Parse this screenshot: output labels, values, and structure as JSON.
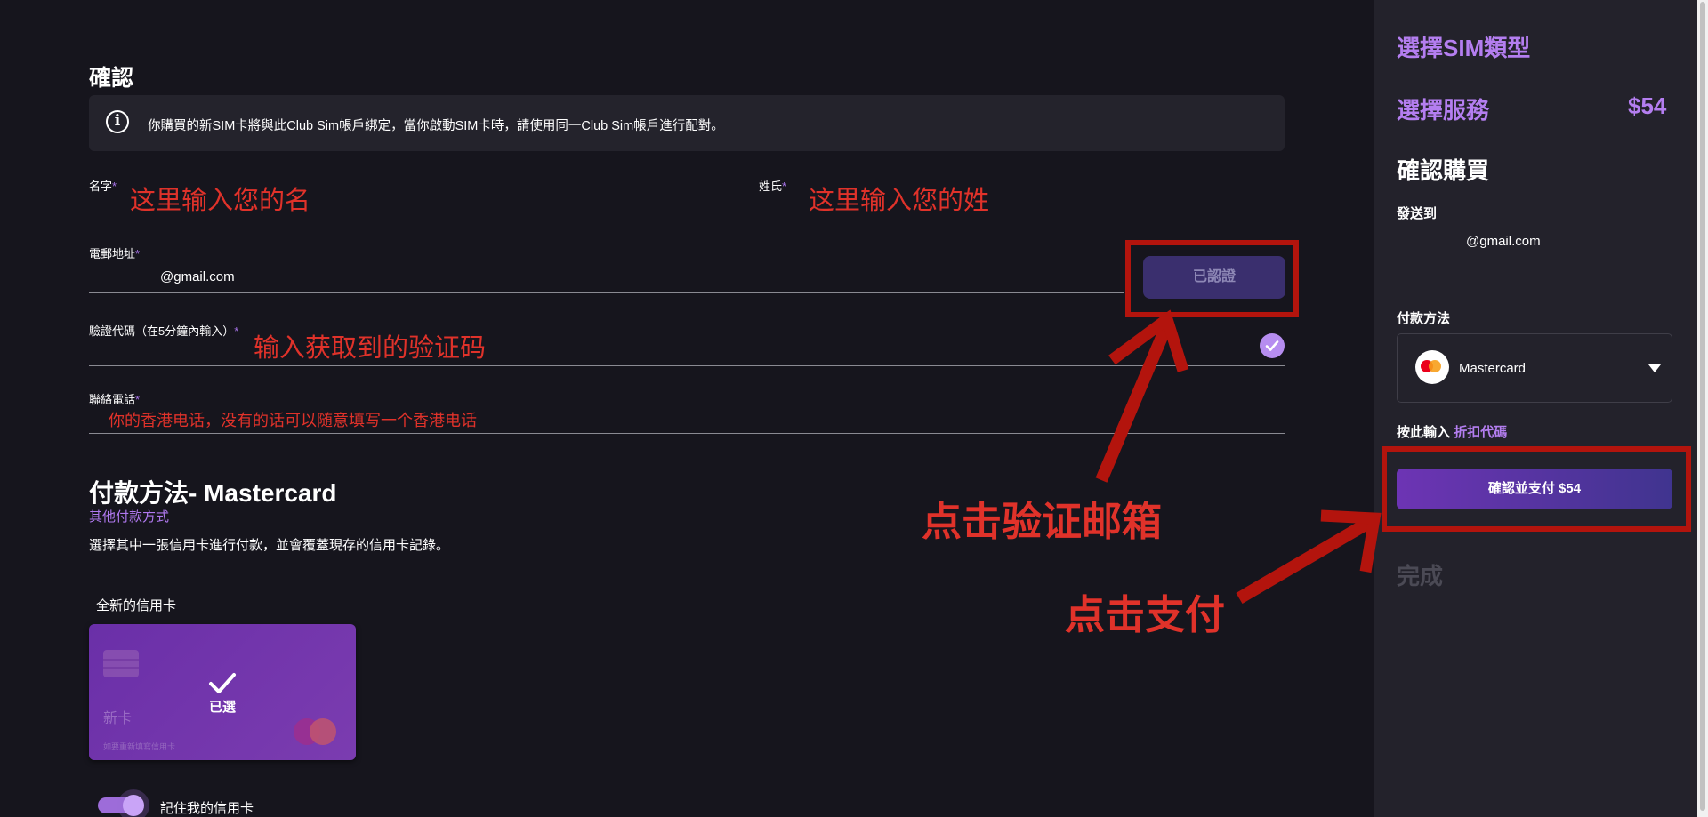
{
  "confirm_section": {
    "title": "確認",
    "info_text": "你購買的新SIM卡將與此Club Sim帳戶綁定，當你啟動SIM卡時，請使用同一Club Sim帳戶進行配對。"
  },
  "form": {
    "first_name": {
      "label": "名字",
      "required_mark": "*",
      "annotation": "这里输入您的名"
    },
    "last_name": {
      "label": "姓氏",
      "required_mark": "*",
      "annotation": "这里输入您的姓"
    },
    "email": {
      "label": "電郵地址",
      "required_mark": "*",
      "value": "@gmail.com",
      "verify_button": "已認證"
    },
    "code": {
      "label": "驗證代碼（在5分鐘內輸入）",
      "required_mark": "*",
      "annotation": "输入获取到的验证码"
    },
    "phone": {
      "label": "聯絡電話",
      "required_mark": "*",
      "annotation": "你的香港电话，没有的话可以随意填写一个香港电话"
    }
  },
  "payment": {
    "title": "付款方法- Mastercard",
    "other_link": "其他付款方式",
    "description": "選擇其中一張信用卡進行付款，並會覆蓋現存的信用卡記錄。",
    "new_card_label": "全新的信用卡",
    "card": {
      "name": "新卡",
      "sub": "如要重新填寫信用卡",
      "selected": "已選"
    },
    "remember": "記住我的信用卡",
    "remember_on": true
  },
  "annotations": {
    "verify_email": "点击验证邮箱",
    "click_pay": "点击支付"
  },
  "sidebar": {
    "step1": "選擇SIM類型",
    "step2": "選擇服務",
    "step2_price": "$54",
    "step3": "確認購買",
    "send_to_label": "發送到",
    "send_to_value": "@gmail.com",
    "payment_label": "付款方法",
    "payment_method": "Mastercard",
    "promo_prefix": "按此輸入",
    "promo_link": "折扣代碼",
    "pay_button": "確認並支付 $54",
    "step4": "完成"
  },
  "colors": {
    "accent": "#b47ef0",
    "annotation_red": "#e0322a",
    "highlight_box": "#b3140d",
    "background": "#16151d",
    "sidebar_bg": "#23222b"
  }
}
